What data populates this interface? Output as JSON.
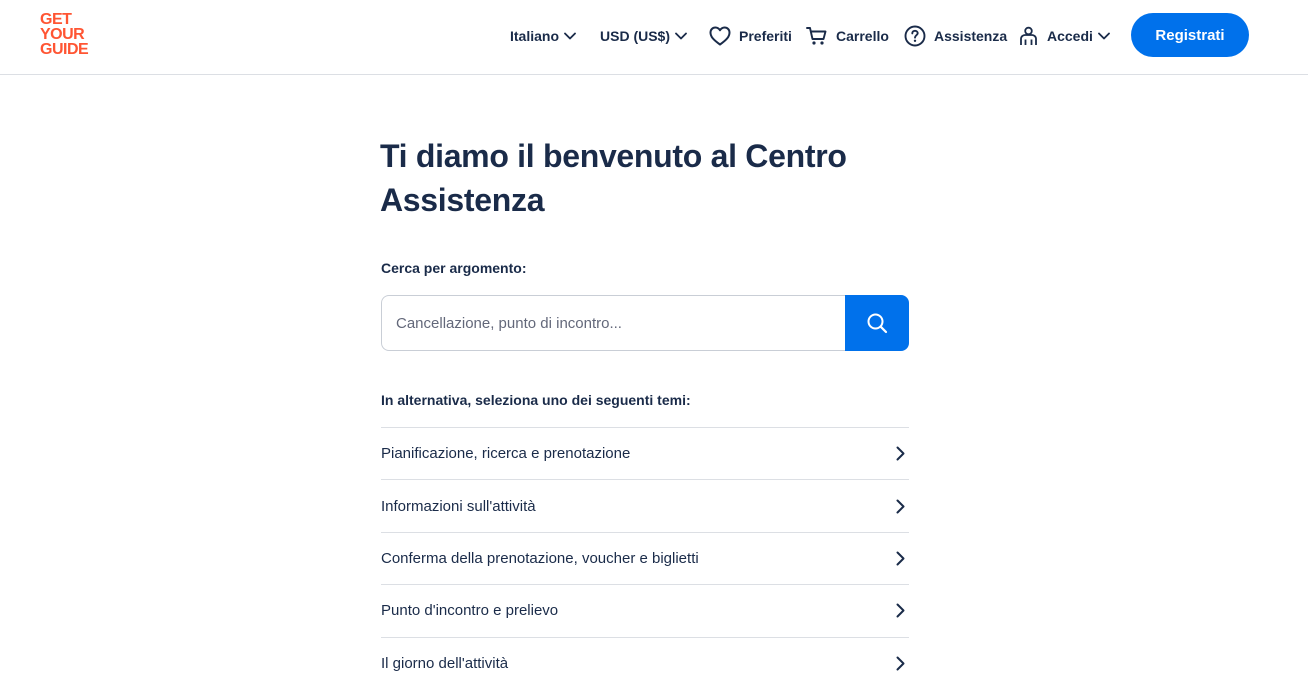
{
  "header": {
    "logo_lines": [
      "GET",
      "YOUR",
      "GUIDE"
    ],
    "language": "Italiano",
    "currency": "USD (US$)",
    "favorites": "Preferiti",
    "cart": "Carrello",
    "help": "Assistenza",
    "login": "Accedi",
    "register": "Registrati"
  },
  "main": {
    "title": "Ti diamo il benvenuto al Centro Assistenza",
    "search_label": "Cerca per argomento:",
    "search_placeholder": "Cancellazione, punto di incontro...",
    "alt_label": "In alternativa, seleziona uno dei seguenti temi:",
    "topics": [
      "Pianificazione, ricerca e prenotazione",
      "Informazioni sull'attività",
      "Conferma della prenotazione, voucher e biglietti",
      "Punto d'incontro e prelievo",
      "Il giorno dell'attività"
    ]
  },
  "colors": {
    "brand_orange": "#ff5533",
    "primary_blue": "#0071eb",
    "text_dark": "#1a2b49"
  }
}
